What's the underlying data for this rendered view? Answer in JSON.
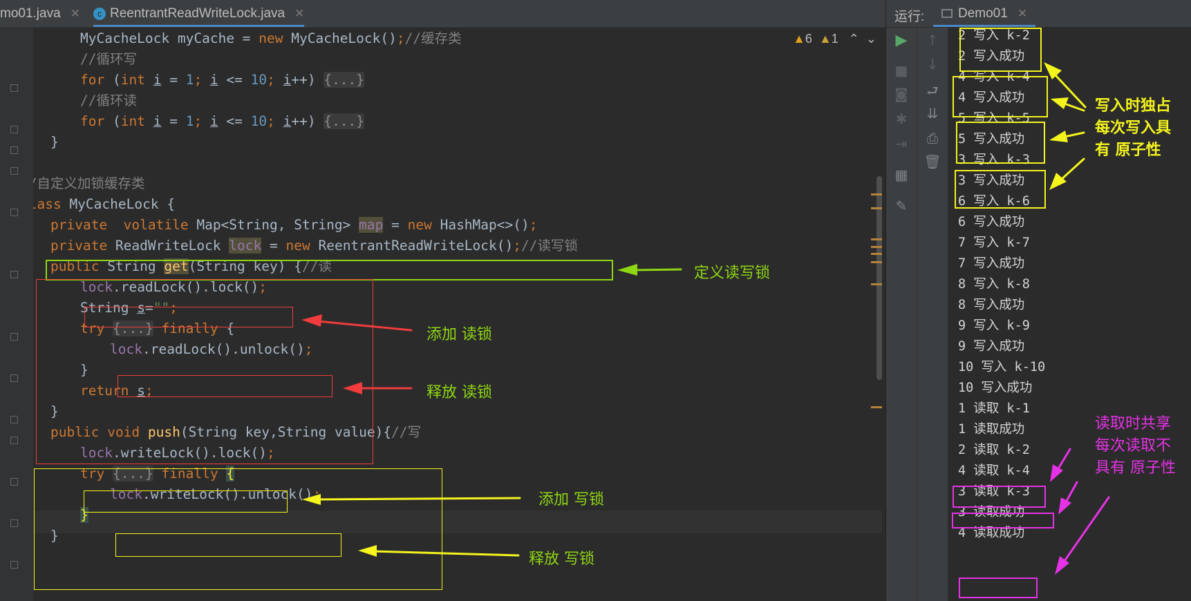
{
  "tabs": [
    {
      "label": "mo01.java",
      "close": "✕"
    },
    {
      "label": "ReentrantReadWriteLock.java",
      "close": "✕",
      "icon": "c-class-icon"
    }
  ],
  "editor": {
    "warnings": {
      "warn_count": "6",
      "weak_count": "1"
    },
    "code": {
      "l1": {
        "a": "MyCacheLock myCache = ",
        "b": "new",
        "c": " MyCacheLock()",
        "d": ";",
        "e": "//缓存类"
      },
      "l2": {
        "a": "//循环写"
      },
      "l3": {
        "a": "for",
        "b": " (",
        "c": "int",
        "d": " ",
        "e": "i",
        "f": " = ",
        "g": "1",
        "h": "; ",
        "i": "i",
        "j": " <= ",
        "k": "10",
        "l": "; ",
        "m": "i",
        "n": "++) ",
        "o": "{...}"
      },
      "l4": {
        "a": "//循环读"
      },
      "l5": {
        "a": "for",
        "b": " (",
        "c": "int",
        "d": " ",
        "e": "i",
        "f": " = ",
        "g": "1",
        "h": "; ",
        "i": "i",
        "j": " <= ",
        "k": "10",
        "l": "; ",
        "m": "i",
        "n": "++) ",
        "o": "{...}"
      },
      "l6": {
        "a": "}"
      },
      "l7": {
        "a": "}"
      },
      "l8": {
        "a": "//自定义加锁缓存类"
      },
      "l9": {
        "a": "class",
        "b": " MyCacheLock {"
      },
      "l10": {
        "a": "private",
        "b": "  ",
        "c": "volatile",
        "d": " Map<String, String> ",
        "e": "map",
        "f": " = ",
        "g": "new",
        "h": " HashMap<>()",
        "i": ";"
      },
      "l11": {
        "a": "private",
        "b": " ReadWriteLock ",
        "c": "lock",
        "d": " = ",
        "e": "new",
        "f": " ReentrantReadWriteLock()",
        "g": ";",
        "h": "//读写锁"
      },
      "l12": {
        "a": "public",
        "b": " String ",
        "c": "get",
        "d": "(String key) {",
        "e": "//读"
      },
      "l13": {
        "a": "lock",
        "b": ".readLock().lock()",
        "c": ";"
      },
      "l14": {
        "a": "String ",
        "b": "s",
        "c": "=",
        "d": "\"\"",
        "e": ";"
      },
      "l15": {
        "a": "try",
        "b": " ",
        "c": "{...}",
        "d": " ",
        "e": "finally",
        "f": " {"
      },
      "l16": {
        "a": "lock",
        "b": ".readLock().unlock()",
        "c": ";"
      },
      "l17": {
        "a": "}"
      },
      "l18": {
        "a": "return",
        "b": " ",
        "c": "s",
        "d": ";"
      },
      "l19": {
        "a": "}"
      },
      "l20": {
        "a": "public",
        "b": " ",
        "c": "void",
        "d": " ",
        "e": "push",
        "f": "(String key,String value){",
        "g": "//写"
      },
      "l21": {
        "a": "lock",
        "b": ".writeLock().lock()",
        "c": ";"
      },
      "l22": {
        "a": "try",
        "b": " ",
        "c": "{...}",
        "d": " ",
        "e": "finally",
        "f": " ",
        "g": "{"
      },
      "l23": {
        "a": "lock",
        "b": ".writeLock().unlock()",
        "c": ";"
      },
      "l24": {
        "a": "}"
      },
      "l25": {
        "a": "}"
      }
    }
  },
  "run": {
    "label": "运行:",
    "tab": "Demo01",
    "close": "✕",
    "output": [
      "2 写入 k-2",
      "2 写入成功",
      "4 写入 k-4",
      "4 写入成功",
      "5 写入 k-5",
      "5 写入成功",
      "3 写入 k-3",
      "3 写入成功",
      "6 写入 k-6",
      "6 写入成功",
      "7 写入 k-7",
      "7 写入成功",
      "8 写入 k-8",
      "8 写入成功",
      "9 写入 k-9",
      "9 写入成功",
      "10 写入 k-10",
      "10 写入成功",
      "1 读取 k-1",
      "1 读取成功",
      "2 读取 k-2",
      "4 读取 k-4",
      "3 读取 k-3",
      "3 读取成功",
      "4 读取成功"
    ]
  },
  "annotations": {
    "define_lock": "定义读写锁",
    "add_read": "添加 读锁",
    "release_read": "释放 读锁",
    "add_write": "添加 写锁",
    "release_write": "释放 写锁",
    "write_note": [
      "写入时独占",
      "每次写入具",
      "有 原子性"
    ],
    "read_note": [
      "读取时共享",
      "每次读取不",
      "具有 原子性"
    ]
  },
  "colors": {
    "green": "#8fd613",
    "red": "#f03c3c",
    "yellow": "#f5f51e",
    "magenta": "#e632e6"
  }
}
